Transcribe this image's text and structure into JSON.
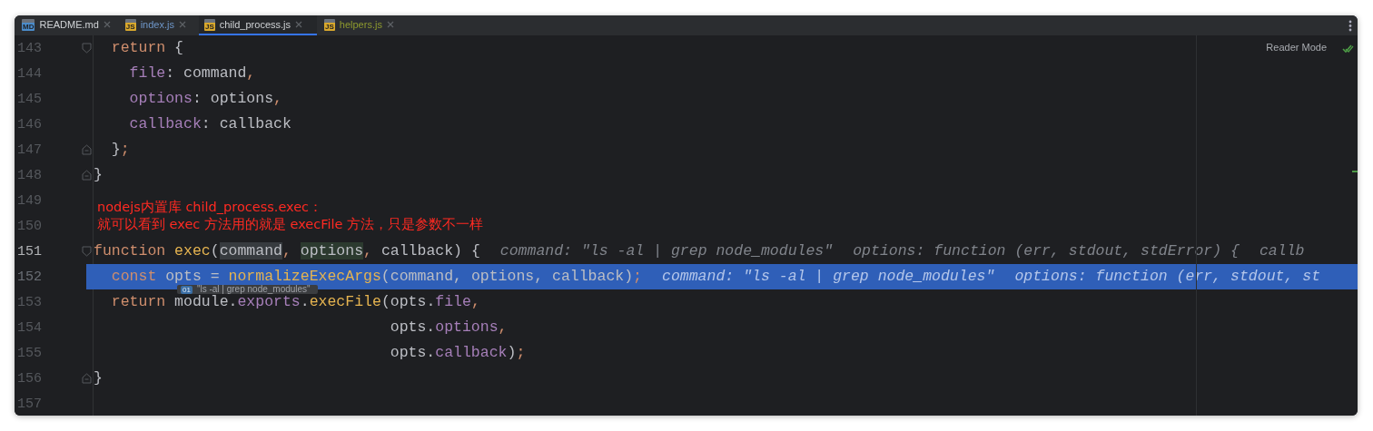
{
  "tabs": [
    {
      "label": "README.md",
      "badge": "MD",
      "color": "#d0d3d6",
      "selected": false
    },
    {
      "label": "index.js",
      "badge": "JS",
      "color": "#6e96c8",
      "selected": false
    },
    {
      "label": "child_process.js",
      "badge": "JS",
      "color": "#d0d3d6",
      "selected": true
    },
    {
      "label": "helpers.js",
      "badge": "JS",
      "color": "#8e9a2e",
      "selected": false
    }
  ],
  "reader_mode": {
    "label": "Reader Mode"
  },
  "lines": [
    {
      "number": "143",
      "fold_start": true,
      "selected": false,
      "current": false,
      "tokens": [
        {
          "t": "  return",
          "kind": "keyword"
        },
        {
          "t": " {",
          "kind": "plain"
        }
      ]
    },
    {
      "number": "144",
      "selected": false,
      "current": false,
      "tokens": [
        {
          "t": "    file",
          "kind": "property"
        },
        {
          "t": ": command",
          "kind": "plain"
        },
        {
          "t": ",",
          "kind": "keyword"
        }
      ]
    },
    {
      "number": "145",
      "selected": false,
      "current": false,
      "tokens": [
        {
          "t": "    options",
          "kind": "property"
        },
        {
          "t": ": options",
          "kind": "plain"
        },
        {
          "t": ",",
          "kind": "keyword"
        }
      ]
    },
    {
      "number": "146",
      "selected": false,
      "current": false,
      "tokens": [
        {
          "t": "    callback",
          "kind": "property"
        },
        {
          "t": ": callback",
          "kind": "plain"
        }
      ]
    },
    {
      "number": "147",
      "fold_end": true,
      "selected": false,
      "current": false,
      "tokens": [
        {
          "t": "  }",
          "kind": "plain"
        },
        {
          "t": ";",
          "kind": "keyword"
        }
      ]
    },
    {
      "number": "148",
      "fold_end": true,
      "selected": false,
      "current": false,
      "tokens": [
        {
          "t": "}",
          "kind": "plain"
        }
      ]
    },
    {
      "number": "149",
      "selected": false,
      "current": false
    },
    {
      "number": "150",
      "selected": false,
      "current": false
    },
    {
      "number": "151",
      "fold_start": true,
      "selected": false,
      "current": true,
      "tokens": [
        {
          "t": "function",
          "kind": "keyword"
        },
        {
          "t": " exec",
          "kind": "function"
        },
        {
          "t": "(",
          "kind": "plain"
        },
        {
          "t": "command",
          "kind": "read"
        },
        {
          "t": ", ",
          "kind": "keyword"
        },
        {
          "t": "options",
          "kind": "write"
        },
        {
          "t": ", ",
          "kind": "keyword"
        },
        {
          "t": "callback) {",
          "kind": "plain"
        }
      ],
      "hints": [
        "command: \"ls -al | grep node_modules\"",
        "options: function (err, stdout, stdError) {",
        "callb"
      ]
    },
    {
      "number": "152",
      "selected": true,
      "current": false,
      "tokens": [
        {
          "t": "  const",
          "kind": "keyword"
        },
        {
          "t": " opts = ",
          "kind": "plain"
        },
        {
          "t": "normalizeExecArgs",
          "kind": "function"
        },
        {
          "t": "(command, options, callback)",
          "kind": "plain"
        },
        {
          "t": ";",
          "kind": "keyword"
        }
      ],
      "hints": [
        "command: \"ls -al | grep node_modules\"",
        "options: function (err, stdout, st"
      ]
    },
    {
      "number": "153",
      "selected": false,
      "current": false,
      "tokens": [
        {
          "t": "  return",
          "kind": "keyword"
        },
        {
          "t": " module.",
          "kind": "plain"
        },
        {
          "t": "exports",
          "kind": "property"
        },
        {
          "t": ".",
          "kind": "plain"
        },
        {
          "t": "execFile",
          "kind": "function"
        },
        {
          "t": "(opts.",
          "kind": "plain"
        },
        {
          "t": "file",
          "kind": "property"
        },
        {
          "t": ",",
          "kind": "keyword"
        }
      ]
    },
    {
      "number": "154",
      "selected": false,
      "current": false,
      "tokens": [
        {
          "t": "                                 opts.",
          "kind": "plain"
        },
        {
          "t": "options",
          "kind": "property"
        },
        {
          "t": ",",
          "kind": "keyword"
        }
      ]
    },
    {
      "number": "155",
      "selected": false,
      "current": false,
      "tokens": [
        {
          "t": "                                 opts.",
          "kind": "plain"
        },
        {
          "t": "callback",
          "kind": "property"
        },
        {
          "t": ")",
          "kind": "plain"
        },
        {
          "t": ";",
          "kind": "keyword"
        }
      ]
    },
    {
      "number": "156",
      "fold_end": true,
      "selected": false,
      "current": false,
      "tokens": [
        {
          "t": "}",
          "kind": "plain"
        }
      ]
    },
    {
      "number": "157",
      "selected": false,
      "current": false
    }
  ],
  "annotation": [
    "nodejs内置库 child_process.exec：",
    "就可以看到 exec 方法用的就是 execFile 方法，只是参数不一样"
  ],
  "tooltip": {
    "badge": "01",
    "text": "\"ls -al | grep node_modules\""
  }
}
